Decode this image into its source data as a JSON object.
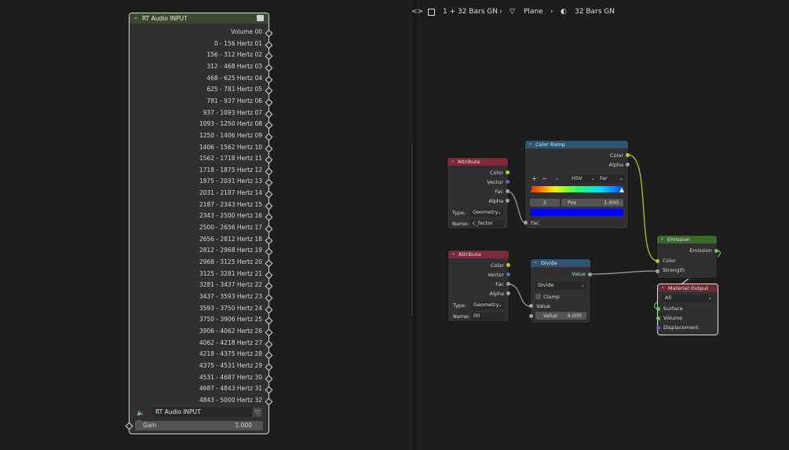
{
  "breadcrumb": {
    "object_name": "1 + 32 Bars GN",
    "mesh_name": "Plane",
    "material_name": "32 Bars GN"
  },
  "rt_node": {
    "title": "RT Audio INPUT",
    "outputs": [
      "Volume 00",
      "0 - 156 Hertz 01",
      "156 - 312 Hertz  02",
      "312 - 468 Hertz  03",
      "468 - 625 Hertz  04",
      "625 - 781 Hertz  05",
      "781 - 937 Hertz  06",
      "937 - 1093 Hertz  07",
      "1093 - 1250 Hertz  08",
      "1250 - 1406 Hertz  09",
      "1406 - 1562 Hertz  10",
      "1562 - 1718 Hertz  11",
      "1718 - 1875 Hertz  12",
      "1875 - 2031 Hertz  13",
      "2031 - 2187 Hertz 14",
      "2187 - 2343 Hertz 15",
      "2343 - 2500 Hertz 16",
      "2500 - 2656 Hertz 17",
      "2656 - 2812 Hertz 18",
      "2812 - 2968 Hertz 19",
      "2968 - 3125 Hertz 20",
      "3125 - 3281 Hertz 21",
      "3281 - 3437 Hertz 22",
      "3437 - 3593 Hertz 23",
      "3593 - 3750 Hertz 24",
      "3750 - 3906 Hertz 25",
      "3906 - 4062 Hertz 26",
      "4062 - 4218 Hertz 27",
      "4218 - 4375 Hertz 28",
      "4375 - 4531 Hertz 29",
      "4531 - 4687 Hertz 30",
      "4687 - 4843 Hertz 31",
      "4843 - 5000 Hertz 32"
    ],
    "source_value": "RT Audio INPUT",
    "gain_label": "Gain",
    "gain_value": "1.000"
  },
  "attribute1": {
    "title": "Attribute",
    "outputs": [
      "Color",
      "Vector",
      "Fac",
      "Alpha"
    ],
    "type_label": "Type:",
    "type_value": "Geometry",
    "name_label": "Name:",
    "name_value": "c_factor"
  },
  "attribute2": {
    "title": "Attribute",
    "outputs": [
      "Color",
      "Vector",
      "Fac",
      "Alpha"
    ],
    "type_label": "Type:",
    "type_value": "Geometry",
    "name_label": "Name:",
    "name_value": "00"
  },
  "color_ramp": {
    "title": "Color Ramp",
    "outputs": [
      "Color",
      "Alpha"
    ],
    "add_label": "+",
    "remove_label": "−",
    "color_mode": "HSV",
    "interpolation": "Far",
    "stop_index": "2",
    "pos_label": "Pos",
    "pos_value": "1.000",
    "input_label": "Fac",
    "selected_color": "#0000ff"
  },
  "divide": {
    "title": "Divide",
    "output": "Value",
    "operation": "Divide",
    "clamp_label": "Clamp",
    "input1": "Value",
    "input2_label": "Value",
    "input2_value": "4.000"
  },
  "emission": {
    "title": "Emission",
    "output": "Emission",
    "inputs": [
      "Color",
      "Strength"
    ]
  },
  "material_output": {
    "title": "Material Output",
    "target": "All",
    "inputs": [
      "Surface",
      "Volume",
      "Displacement"
    ]
  },
  "colors": {
    "geometry_header": "#3b4a2e",
    "attribute_header": "#7b2a3c",
    "converter_header": "#2c5574",
    "shader_header": "#3a6a2a",
    "output_header": "#6a2a34",
    "socket_color": "#c7c729",
    "socket_vector": "#6363c7",
    "socket_float": "#a1a1a1",
    "socket_shader": "#63c763"
  }
}
